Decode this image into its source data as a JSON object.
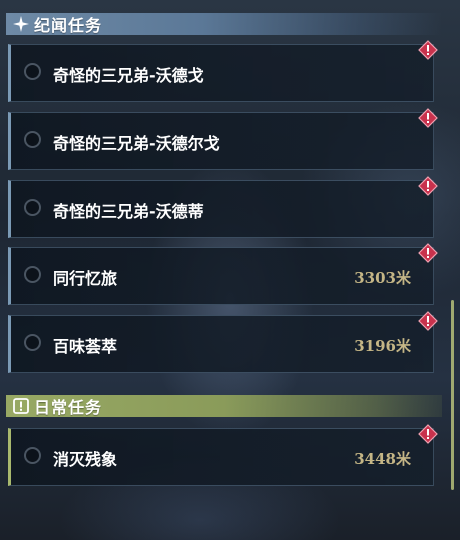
{
  "story_section": {
    "title": "纪闻任务",
    "icon": "sparkle-icon",
    "accent_color": "#6e8aa6",
    "quests": [
      {
        "name": "奇怪的三兄弟-沃德戈",
        "distance": ""
      },
      {
        "name": "奇怪的三兄弟-沃德尔戈",
        "distance": ""
      },
      {
        "name": "奇怪的三兄弟-沃德蒂",
        "distance": ""
      },
      {
        "name": "同行忆旅",
        "distance": "3303米"
      },
      {
        "name": "百味荟萃",
        "distance": "3196米"
      }
    ]
  },
  "daily_section": {
    "title": "日常任务",
    "icon": "exclamation-box-icon",
    "accent_color": "#98a964",
    "quests": [
      {
        "name": "消灭残象",
        "distance": "3448米"
      }
    ]
  },
  "alert_icon": {
    "name": "alert-diamond-icon",
    "color": "#d23a55"
  },
  "distance_color": "#c5b686"
}
